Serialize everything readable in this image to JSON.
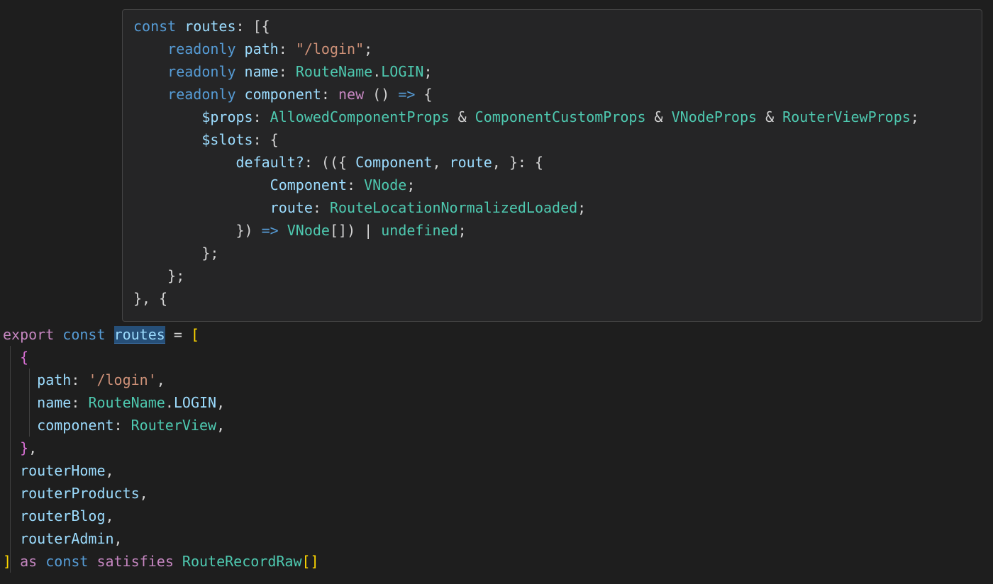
{
  "editor": {
    "lines": [
      {
        "indent": 0,
        "tokens": [
          {
            "t": "export",
            "c": "kwc"
          },
          {
            "t": " ",
            "c": "pn"
          },
          {
            "t": "const",
            "c": "kw"
          },
          {
            "t": " ",
            "c": "pn"
          },
          {
            "t": "routes",
            "c": "var",
            "hl": true
          },
          {
            "t": " = ",
            "c": "pn"
          },
          {
            "t": "[",
            "c": "br1"
          }
        ]
      },
      {
        "indent": 1,
        "tokens": [
          {
            "t": "{",
            "c": "br2"
          }
        ]
      },
      {
        "indent": 2,
        "tokens": [
          {
            "t": "path",
            "c": "var"
          },
          {
            "t": ": ",
            "c": "pn"
          },
          {
            "t": "'/login'",
            "c": "str"
          },
          {
            "t": ",",
            "c": "pn"
          }
        ]
      },
      {
        "indent": 2,
        "tokens": [
          {
            "t": "name",
            "c": "var"
          },
          {
            "t": ": ",
            "c": "pn"
          },
          {
            "t": "RouteName",
            "c": "ty"
          },
          {
            "t": ".",
            "c": "pn"
          },
          {
            "t": "LOGIN",
            "c": "var"
          },
          {
            "t": ",",
            "c": "pn"
          }
        ]
      },
      {
        "indent": 2,
        "tokens": [
          {
            "t": "component",
            "c": "var"
          },
          {
            "t": ": ",
            "c": "pn"
          },
          {
            "t": "RouterView",
            "c": "ty"
          },
          {
            "t": ",",
            "c": "pn"
          }
        ]
      },
      {
        "indent": 1,
        "tokens": [
          {
            "t": "}",
            "c": "br2"
          },
          {
            "t": ",",
            "c": "pn"
          }
        ]
      },
      {
        "indent": 1,
        "tokens": [
          {
            "t": "routerHome",
            "c": "var"
          },
          {
            "t": ",",
            "c": "pn"
          }
        ]
      },
      {
        "indent": 1,
        "tokens": [
          {
            "t": "routerProducts",
            "c": "var"
          },
          {
            "t": ",",
            "c": "pn"
          }
        ]
      },
      {
        "indent": 1,
        "tokens": [
          {
            "t": "routerBlog",
            "c": "var"
          },
          {
            "t": ",",
            "c": "pn"
          }
        ]
      },
      {
        "indent": 1,
        "tokens": [
          {
            "t": "routerAdmin",
            "c": "var"
          },
          {
            "t": ",",
            "c": "pn"
          }
        ]
      },
      {
        "indent": 0,
        "tokens": [
          {
            "t": "]",
            "c": "br1"
          },
          {
            "t": " ",
            "c": "pn"
          },
          {
            "t": "as",
            "c": "kwc"
          },
          {
            "t": " ",
            "c": "pn"
          },
          {
            "t": "const",
            "c": "kw"
          },
          {
            "t": " ",
            "c": "pn"
          },
          {
            "t": "satisfies",
            "c": "kwc"
          },
          {
            "t": " ",
            "c": "pn"
          },
          {
            "t": "RouteRecordRaw",
            "c": "ty"
          },
          {
            "t": "[]",
            "c": "br1"
          }
        ]
      }
    ]
  },
  "hover": {
    "lines": [
      {
        "indent": 0,
        "tokens": [
          {
            "t": "const",
            "c": "kw"
          },
          {
            "t": " ",
            "c": "pn"
          },
          {
            "t": "routes",
            "c": "var"
          },
          {
            "t": ": [{",
            "c": "pn"
          }
        ]
      },
      {
        "indent": 1,
        "tokens": [
          {
            "t": "readonly",
            "c": "kw"
          },
          {
            "t": " ",
            "c": "pn"
          },
          {
            "t": "path",
            "c": "var"
          },
          {
            "t": ": ",
            "c": "pn"
          },
          {
            "t": "\"/login\"",
            "c": "str"
          },
          {
            "t": ";",
            "c": "pn"
          }
        ]
      },
      {
        "indent": 1,
        "tokens": [
          {
            "t": "readonly",
            "c": "kw"
          },
          {
            "t": " ",
            "c": "pn"
          },
          {
            "t": "name",
            "c": "var"
          },
          {
            "t": ": ",
            "c": "pn"
          },
          {
            "t": "RouteName",
            "c": "ty"
          },
          {
            "t": ".",
            "c": "pn"
          },
          {
            "t": "LOGIN",
            "c": "ty"
          },
          {
            "t": ";",
            "c": "pn"
          }
        ]
      },
      {
        "indent": 1,
        "tokens": [
          {
            "t": "readonly",
            "c": "kw"
          },
          {
            "t": " ",
            "c": "pn"
          },
          {
            "t": "component",
            "c": "var"
          },
          {
            "t": ": ",
            "c": "pn"
          },
          {
            "t": "new",
            "c": "kwc"
          },
          {
            "t": " () ",
            "c": "pn"
          },
          {
            "t": "=>",
            "c": "kw"
          },
          {
            "t": " {",
            "c": "pn"
          }
        ]
      },
      {
        "indent": 2,
        "tokens": [
          {
            "t": "$props",
            "c": "var"
          },
          {
            "t": ": ",
            "c": "pn"
          },
          {
            "t": "AllowedComponentProps",
            "c": "ty"
          },
          {
            "t": " & ",
            "c": "pn"
          },
          {
            "t": "ComponentCustomProps",
            "c": "ty"
          },
          {
            "t": " & ",
            "c": "pn"
          },
          {
            "t": "VNodeProps",
            "c": "ty"
          },
          {
            "t": " & ",
            "c": "pn"
          },
          {
            "t": "RouterViewProps",
            "c": "ty"
          },
          {
            "t": ";",
            "c": "pn"
          }
        ]
      },
      {
        "indent": 2,
        "tokens": [
          {
            "t": "$slots",
            "c": "var"
          },
          {
            "t": ": {",
            "c": "pn"
          }
        ]
      },
      {
        "indent": 3,
        "tokens": [
          {
            "t": "default?",
            "c": "var"
          },
          {
            "t": ": (({ ",
            "c": "pn"
          },
          {
            "t": "Component",
            "c": "var"
          },
          {
            "t": ", ",
            "c": "pn"
          },
          {
            "t": "route",
            "c": "var"
          },
          {
            "t": ", }: {",
            "c": "pn"
          }
        ]
      },
      {
        "indent": 4,
        "tokens": [
          {
            "t": "Component",
            "c": "var"
          },
          {
            "t": ": ",
            "c": "pn"
          },
          {
            "t": "VNode",
            "c": "ty"
          },
          {
            "t": ";",
            "c": "pn"
          }
        ]
      },
      {
        "indent": 4,
        "tokens": [
          {
            "t": "route",
            "c": "var"
          },
          {
            "t": ": ",
            "c": "pn"
          },
          {
            "t": "RouteLocationNormalizedLoaded",
            "c": "ty"
          },
          {
            "t": ";",
            "c": "pn"
          }
        ]
      },
      {
        "indent": 3,
        "tokens": [
          {
            "t": "}) ",
            "c": "pn"
          },
          {
            "t": "=>",
            "c": "kw"
          },
          {
            "t": " ",
            "c": "pn"
          },
          {
            "t": "VNode",
            "c": "ty"
          },
          {
            "t": "[]) | ",
            "c": "pn"
          },
          {
            "t": "undefined",
            "c": "ty"
          },
          {
            "t": ";",
            "c": "pn"
          }
        ]
      },
      {
        "indent": 2,
        "tokens": [
          {
            "t": "};",
            "c": "pn"
          }
        ]
      },
      {
        "indent": 1,
        "tokens": [
          {
            "t": "};",
            "c": "pn"
          }
        ]
      },
      {
        "indent": 0,
        "tokens": [
          {
            "t": "}, {",
            "c": "pn"
          }
        ]
      },
      {
        "indent": 2,
        "tokens": [
          {
            "t": ".",
            "c": "pn"
          }
        ]
      }
    ]
  },
  "colors": {
    "background": "#1e1e1e",
    "hover_background": "#252526",
    "keyword": "#569cd6",
    "control_keyword": "#c586c0",
    "variable": "#9cdcfe",
    "type": "#4ec9b0",
    "string": "#ce9178",
    "bracket_level1": "#ffd700",
    "bracket_level2": "#da70d6"
  }
}
